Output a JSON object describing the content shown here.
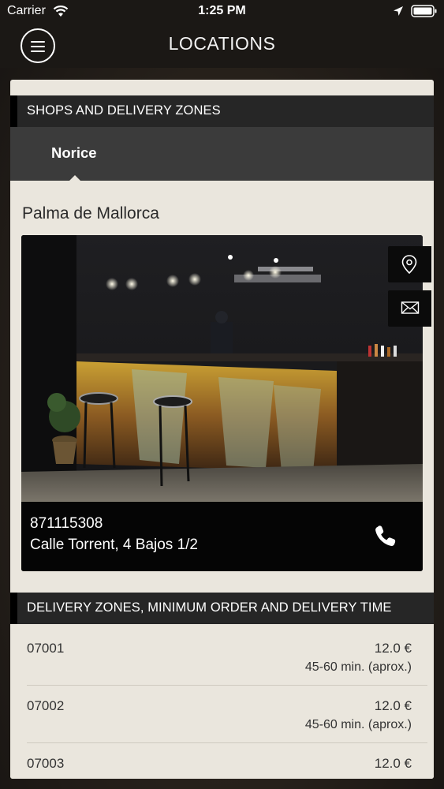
{
  "status_bar": {
    "carrier": "Carrier",
    "time": "1:25 PM",
    "icons": [
      "wifi-icon",
      "location-arrow-icon",
      "battery-icon"
    ]
  },
  "nav": {
    "title": "LOCATIONS",
    "menu_icon": "menu-icon"
  },
  "shops_section": {
    "header": "SHOPS AND DELIVERY ZONES",
    "tabs": [
      {
        "label": "Norice",
        "selected": true
      }
    ]
  },
  "shop": {
    "city": "Palma de Mallorca",
    "phone": "871115308",
    "address": "Calle Torrent, 4 Bajos 1/2",
    "actions": [
      "map-pin-icon",
      "mail-icon",
      "phone-icon"
    ]
  },
  "delivery_section": {
    "header": "DELIVERY ZONES, MINIMUM ORDER AND DELIVERY TIME",
    "zones": [
      {
        "code": "07001",
        "min_order": "12.0 €",
        "time": "45-60 min. (aprox.)"
      },
      {
        "code": "07002",
        "min_order": "12.0 €",
        "time": "45-60 min. (aprox.)"
      },
      {
        "code": "07003",
        "min_order": "12.0 €",
        "time": ""
      }
    ]
  },
  "colors": {
    "bar_bg": "#1b1815",
    "card_bg": "#eae6dd",
    "section_header_bg": "#262626",
    "tab_bar_bg": "#3b3b3b"
  }
}
